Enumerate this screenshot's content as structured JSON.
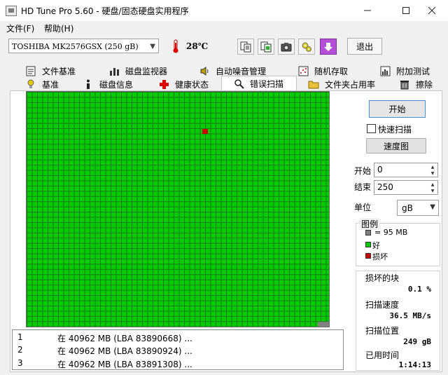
{
  "window": {
    "title": "HD Tune Pro 5.60 - 硬盘/固态硬盘实用程序",
    "minimize_icon": "minimize-icon",
    "maximize_icon": "maximize-icon",
    "close_icon": "close-icon"
  },
  "menu": {
    "file": "文件(F)",
    "help": "帮助(H)"
  },
  "toolbar": {
    "drive": "TOSHIBA MK2576GSX (250 gB)",
    "temperature": "28℃",
    "exit": "退出",
    "buttons": [
      "copy-info-icon",
      "copy-screen-icon",
      "camera-icon",
      "options-icon",
      "download-icon"
    ]
  },
  "tabs": {
    "row1": [
      "文件基准",
      "磁盘监视器",
      "自动噪音管理",
      "随机存取",
      "附加测试"
    ],
    "row2": [
      "基准",
      "磁盘信息",
      "健康状态",
      "错误扫描",
      "文件夹占用率",
      "擦除"
    ],
    "active": "错误扫描"
  },
  "scan": {
    "start_button": "开始",
    "quick_scan": "快速扫描",
    "quick_scan_checked": false,
    "speed_map_button": "速度图",
    "start_label": "开始",
    "start_value": "0",
    "end_label": "结束",
    "end_value": "250",
    "unit_label": "单位",
    "unit_value": "gB",
    "legend_title": "图例",
    "legend_block": "= 95 MB",
    "legend_good": "好",
    "legend_bad": "损坏",
    "damaged_blocks_label": "损坏的块",
    "damaged_blocks_value": "0.1 %",
    "scan_speed_label": "扫描速度",
    "scan_speed_value": "36.5 MB/s",
    "scan_position_label": "扫描位置",
    "scan_position_value": "249 gB",
    "elapsed_label": "已用时间",
    "elapsed_value": "1:14:13"
  },
  "log": [
    {
      "num": "1",
      "msg": "在 40962 MB (LBA 83890668) ..."
    },
    {
      "num": "2",
      "msg": "在 40962 MB (LBA 83890924) ..."
    },
    {
      "num": "3",
      "msg": "在 40962 MB (LBA 83891308) ..."
    }
  ],
  "colors": {
    "good": "#00cc00",
    "bad": "#cc0000",
    "unscanned": "#808080"
  }
}
